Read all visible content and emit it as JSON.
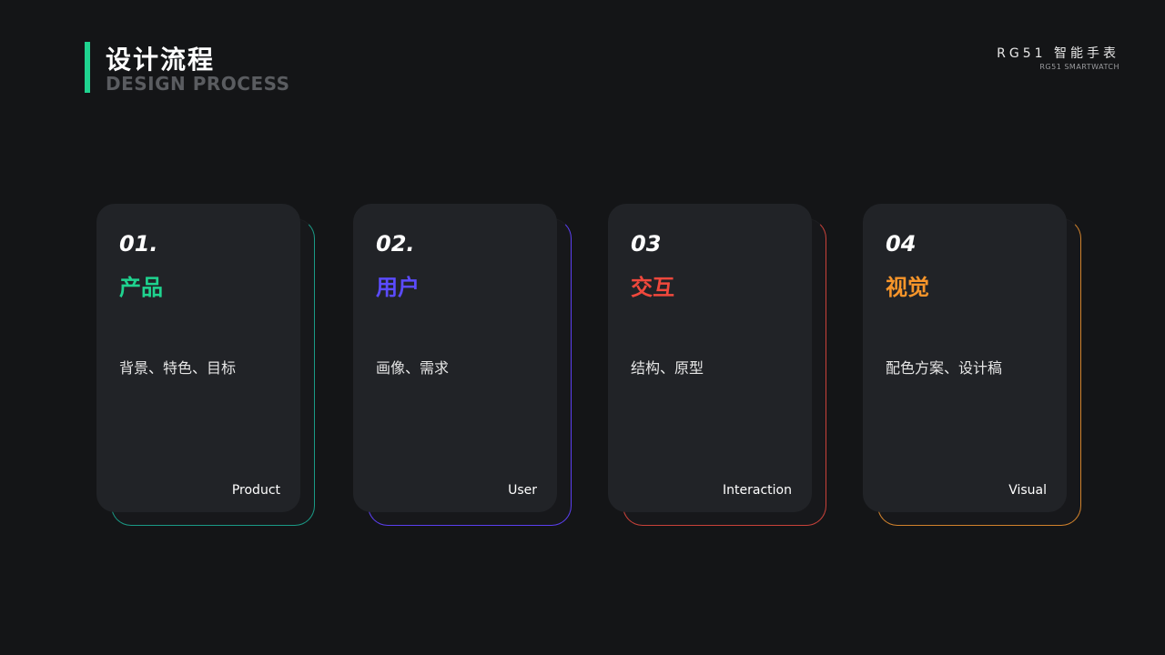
{
  "header": {
    "title_cn": "设计流程",
    "title_en": "DESIGN PROCESS",
    "accent_color": "#1fd38f"
  },
  "brand": {
    "name_cn": "RG51 智能手表",
    "name_en": "RG51 SMARTWATCH"
  },
  "cards": [
    {
      "number": "01.",
      "title": "产品",
      "description": "背景、特色、目标",
      "label_en": "Product",
      "color": "#1fd38f",
      "border_color": "#1a9a86"
    },
    {
      "number": "02.",
      "title": "用户",
      "description": "画像、需求",
      "label_en": "User",
      "color": "#5b4bff",
      "border_color": "#5b3ff0"
    },
    {
      "number": "03",
      "title": "交互",
      "description": "结构、原型",
      "label_en": "Interaction",
      "color": "#f0483c",
      "border_color": "#c9423a"
    },
    {
      "number": "04",
      "title": "视觉",
      "description": "配色方案、设计稿",
      "label_en": "Visual",
      "color": "#f7952a",
      "border_color": "#d1822c"
    }
  ]
}
